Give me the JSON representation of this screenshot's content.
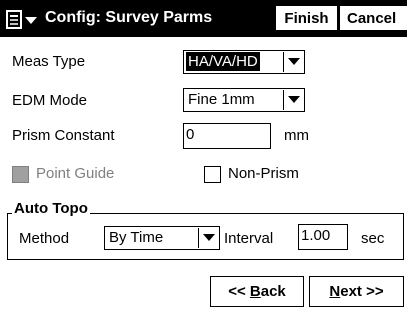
{
  "header": {
    "menu_icon": "start-menu-icon",
    "title": "Config: Survey Parms",
    "finish_label": "Finish",
    "cancel_label": "Cancel"
  },
  "form": {
    "meas_type": {
      "label": "Meas Type",
      "value": "HA/VA/HD"
    },
    "edm_mode": {
      "label": "EDM Mode",
      "value": "Fine 1mm"
    },
    "prism_constant": {
      "label": "Prism Constant",
      "value": "0",
      "unit": "mm"
    },
    "point_guide": {
      "label": "Point Guide",
      "checked": false,
      "enabled": false
    },
    "non_prism": {
      "label": "Non-Prism",
      "checked": false
    }
  },
  "auto_topo": {
    "title": "Auto Topo",
    "method_label": "Method",
    "method_value": "By Time",
    "interval_label": "Interval",
    "interval_value": "1.00",
    "interval_unit": "sec"
  },
  "nav": {
    "back_prefix": "<< ",
    "back_key": "B",
    "back_rest": "ack",
    "next_key": "N",
    "next_rest": "ext >>"
  }
}
